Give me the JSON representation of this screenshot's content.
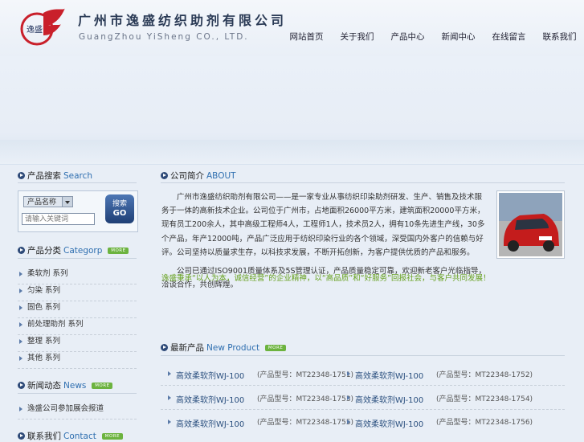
{
  "header": {
    "company_cn": "广州市逸盛纺织助剂有限公司",
    "company_en": "GuangZhou YiSheng CO., LTD.",
    "logo_text": "逸盛",
    "nav": [
      "网站首页",
      "关于我们",
      "产品中心",
      "新闻中心",
      "在线留言",
      "联系我们"
    ]
  },
  "search": {
    "title_cn": "产品搜索",
    "title_en": "Search",
    "select_value": "产品名称",
    "placeholder": "请输入关键词",
    "button_cn": "搜索",
    "button_en": "GO"
  },
  "category": {
    "title_cn": "产品分类",
    "title_en": "Categorp",
    "more": "MORE",
    "items": [
      "柔软剂 系列",
      "匀染 系列",
      "固色 系列",
      "前处理助剂 系列",
      "整理 系列",
      "其他 系列"
    ]
  },
  "news": {
    "title_cn": "新闻动态",
    "title_en": "News",
    "more": "MORE",
    "items": [
      "逸盛公司参加展会报道"
    ]
  },
  "contact": {
    "title_cn": "联系我们",
    "title_en": "Contact",
    "more": "MORE"
  },
  "about": {
    "title_cn": "公司简介",
    "title_en": "ABOUT",
    "paragraph1": "广州市逸盛纺织助剂有限公司——是一家专业从事纺织印染助剂研发、生产、销售及技术服务于一体的高新技术企业。公司位于广州市，占地面积26000平方米，建筑面积20000平方米，现有员工200余人，其中高级工程师4人，工程师1人，技术员2人，拥有10条先进生产线，30多个产品，年产12000吨，产品广泛应用于纺织印染行业的各个领域，深受国内外客户的信赖与好评。公司坚持以质量求生存，以科技求发展，不断开拓创新，为客户提供优质的产品和服务。",
    "paragraph2": "公司已通过ISO9001质量体系及5S管理认证，产品质量稳定可靠，欢迎新老客户光临指导，洽谈合作，共创辉煌。",
    "slogan": "逸盛秉承“以人为本，诚信经营”的企业精神，以“高品质”和“好服务”回报社会，与客户共同发展！"
  },
  "products": {
    "title_cn": "最新产品",
    "title_en": "New Product",
    "more": "MORE",
    "items": [
      {
        "name": "高效柔软剂WJ-100",
        "code": "(产品型号：MT22348-1751)"
      },
      {
        "name": "高效柔软剂WJ-100",
        "code": "(产品型号：MT22348-1752)"
      },
      {
        "name": "高效柔软剂WJ-100",
        "code": "(产品型号：MT22348-1753)"
      },
      {
        "name": "高效柔软剂WJ-100",
        "code": "(产品型号：MT22348-1754)"
      },
      {
        "name": "高效柔软剂WJ-100",
        "code": "(产品型号：MT22348-1755)"
      },
      {
        "name": "高效柔软剂WJ-100",
        "code": "(产品型号：MT22348-1756)"
      }
    ]
  },
  "colors": {
    "accent": "#2f6fb0",
    "nav_text": "#222233",
    "slogan": "#66a01e",
    "more_badge": "#6cb33f"
  }
}
